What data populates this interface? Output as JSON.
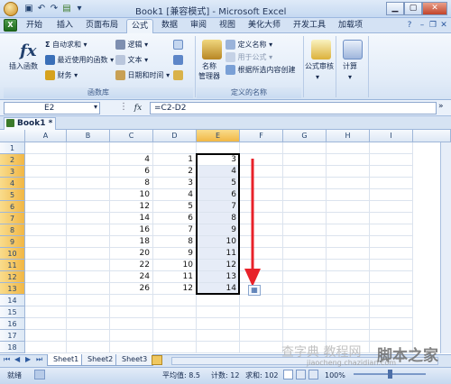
{
  "title": "Book1  [兼容模式] - Microsoft Excel",
  "tabs": [
    "开始",
    "插入",
    "页面布局",
    "公式",
    "数据",
    "审阅",
    "视图",
    "美化大师",
    "开发工具",
    "加载项"
  ],
  "ribbon": {
    "insert_function": "插入函数",
    "autosum": "自动求和 ▾",
    "recent": "最近使用的函数 ▾",
    "financial": "财务 ▾",
    "logical": "逻辑 ▾",
    "text": "文本 ▾",
    "datetime": "日期和时间 ▾",
    "group_lib": "函数库",
    "name_manager": "名称\n管理器",
    "define_name": "定义名称 ▾",
    "use_in_formula": "用于公式 ▾",
    "create_from_sel": "根据所选内容创建",
    "group_names": "定义的名称",
    "formula_audit": "公式审核",
    "calc": "计算"
  },
  "formula_bar": {
    "name_box": "E2",
    "fx": "fx",
    "formula": "=C2-D2"
  },
  "workbook_tab": "Book1 *",
  "columns": [
    "A",
    "B",
    "C",
    "D",
    "E",
    "F",
    "G",
    "H",
    "I"
  ],
  "rows": [
    "1",
    "2",
    "3",
    "4",
    "5",
    "6",
    "7",
    "8",
    "9",
    "10",
    "11",
    "12",
    "13",
    "14",
    "15",
    "16",
    "17",
    "18"
  ],
  "data": {
    "C": [
      "4",
      "6",
      "8",
      "10",
      "12",
      "14",
      "16",
      "18",
      "20",
      "22",
      "24",
      "26"
    ],
    "D": [
      "1",
      "2",
      "3",
      "4",
      "5",
      "6",
      "7",
      "8",
      "9",
      "10",
      "11",
      "12"
    ],
    "E": [
      "3",
      "4",
      "5",
      "6",
      "7",
      "8",
      "9",
      "10",
      "11",
      "12",
      "13",
      "14"
    ]
  },
  "sheets": [
    "Sheet1",
    "Sheet2",
    "Sheet3"
  ],
  "status": {
    "ready": "就绪",
    "average": "平均值: 8.5",
    "count": "计数: 12",
    "sum": "求和: 102",
    "zoom": "100%"
  },
  "watermark": {
    "logo": "脚本之家",
    "url": "jiaocheng.chazidian.com",
    "sub": "查字典 教程网"
  },
  "colors": {
    "accent": "#2d5aa0",
    "selection_header": "#f1b745",
    "arrow": "#e8222a"
  }
}
